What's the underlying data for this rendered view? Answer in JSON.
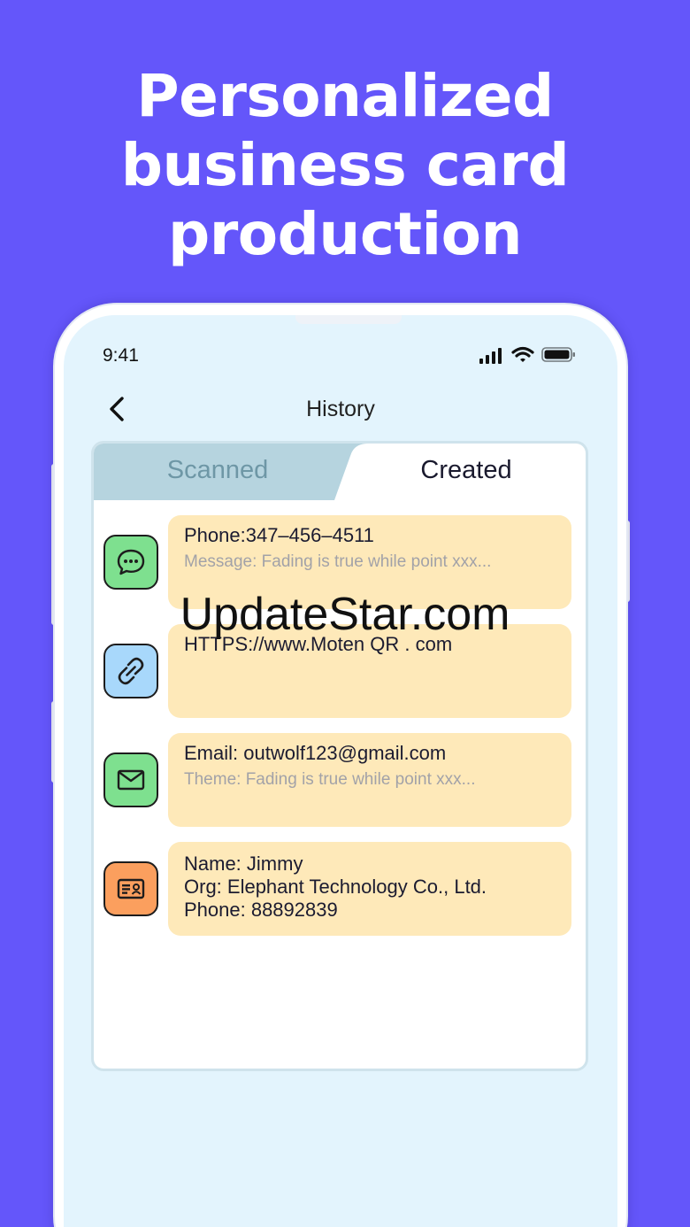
{
  "headline": {
    "line1": "Personalized",
    "line2": "business card",
    "line3": "production"
  },
  "status_bar": {
    "time": "9:41",
    "icons": [
      "signal-icon",
      "wifi-icon",
      "battery-icon"
    ]
  },
  "nav": {
    "back_icon": "chevron-left-icon",
    "title": "History"
  },
  "tabs": {
    "scanned": "Scanned",
    "created": "Created",
    "active": "Created"
  },
  "items": [
    {
      "icon": "message-bubble-icon",
      "icon_color": "#7ee08f",
      "main": "Phone:347–456–4511",
      "sub": "Message: Fading is true while point xxx..."
    },
    {
      "icon": "link-icon",
      "icon_color": "#a8d8fb",
      "main": "HTTPS://www.Moten QR . com",
      "sub": ""
    },
    {
      "icon": "mail-icon",
      "icon_color": "#7ee08f",
      "main": "Email: outwolf123@gmail.com",
      "sub": "Theme:  Fading is true while point xxx..."
    },
    {
      "icon": "contact-card-icon",
      "icon_color": "#fb9f5e",
      "lines": [
        "Name: Jimmy",
        "Org:  Elephant Technology Co., Ltd.",
        "Phone: 88892839"
      ]
    }
  ],
  "watermark": "UpdateStar.com",
  "colors": {
    "background": "#6456fa",
    "screen": "#e3f4fd",
    "card": "#fee9b9",
    "tab_inactive": "#b6d4df"
  }
}
